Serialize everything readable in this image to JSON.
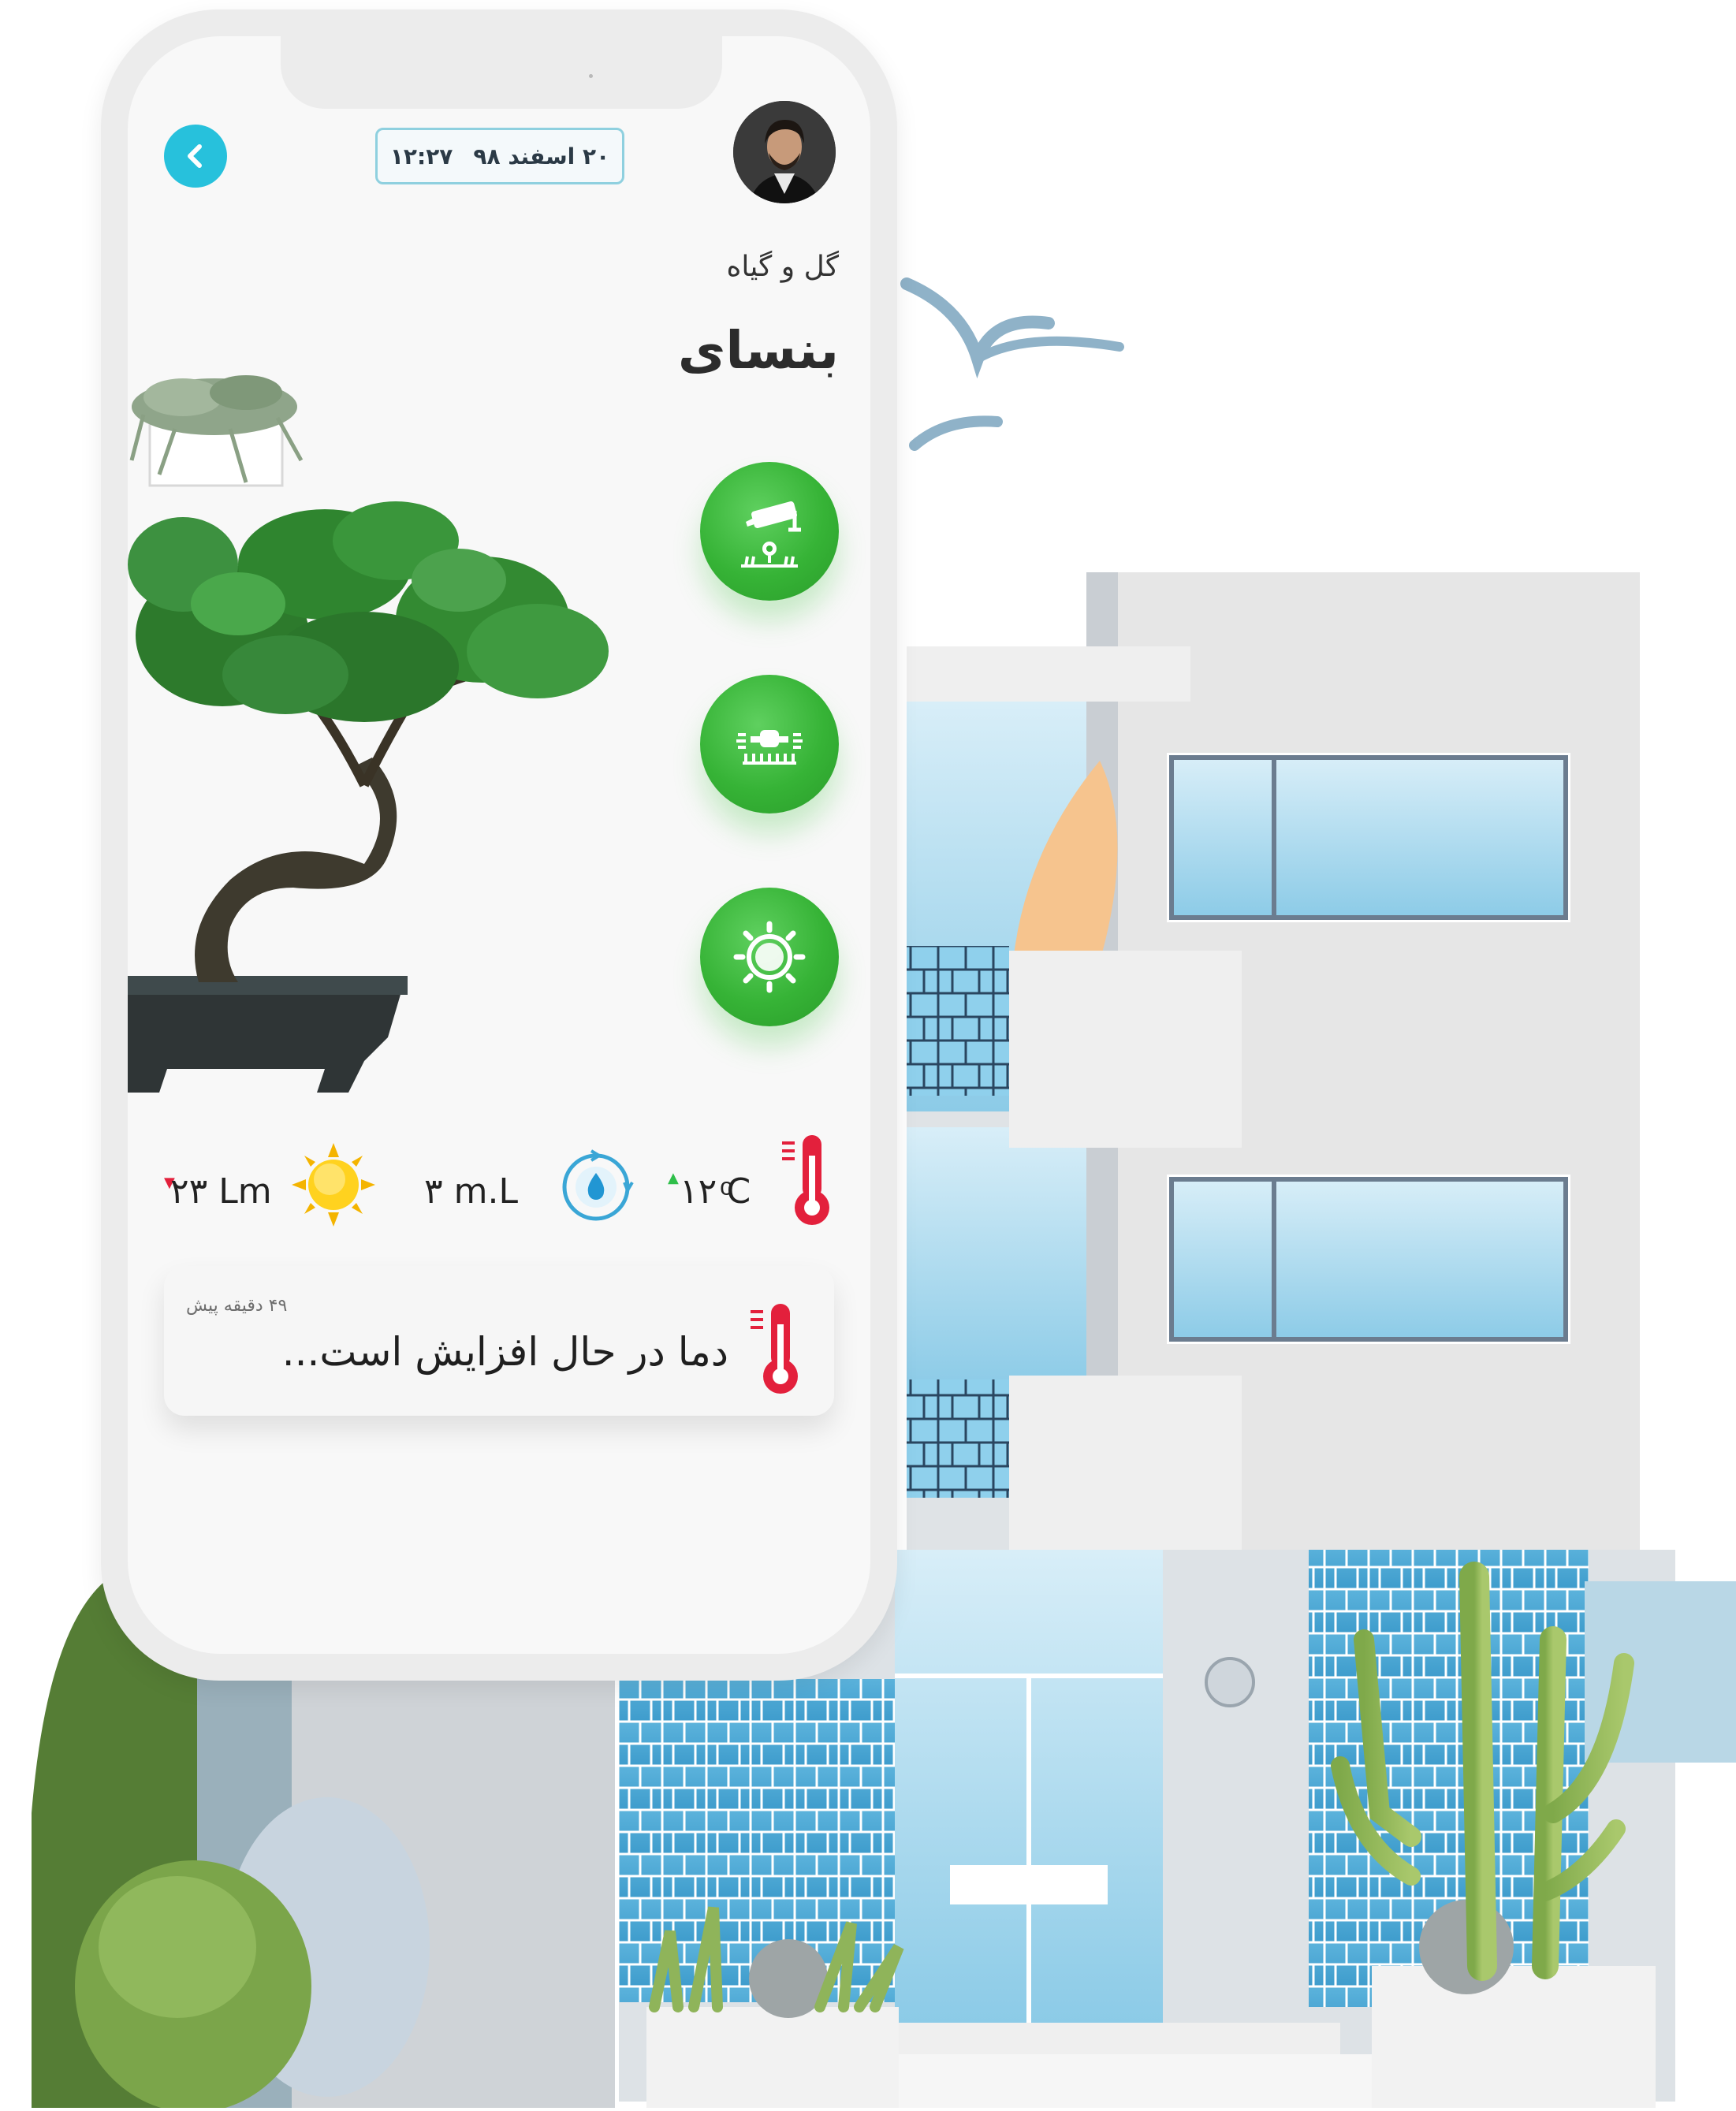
{
  "header": {
    "back_icon": "chevron-left-icon",
    "date": "۲۰ اسفند ۹۸",
    "time": "۱۲:۲۷",
    "avatar": "user-avatar-photo"
  },
  "plant": {
    "category": "گل و گیاه",
    "name": "بنسای"
  },
  "actions": [
    {
      "icon": "camera-flower-icon"
    },
    {
      "icon": "sprinkler-icon"
    },
    {
      "icon": "sun-icon"
    }
  ],
  "stats": {
    "temperature": {
      "value": "۱۲ ͦC",
      "trend": "up",
      "trend_color": "#2fbf4a",
      "icon": "thermometer-icon"
    },
    "water": {
      "value": "۳ m.L",
      "icon": "water-cycle-icon"
    },
    "light": {
      "value": "۲۳ Lm",
      "trend": "down",
      "trend_color": "#e3203c",
      "icon": "sun-icon"
    }
  },
  "notification": {
    "time": "۴۹ دقیقه پیش",
    "message": "دما در حال افزایش است...",
    "icon": "thermometer-icon"
  },
  "colors": {
    "accent": "#27c1dc",
    "action_green": "#36b336",
    "thermo_red": "#e3203c"
  }
}
